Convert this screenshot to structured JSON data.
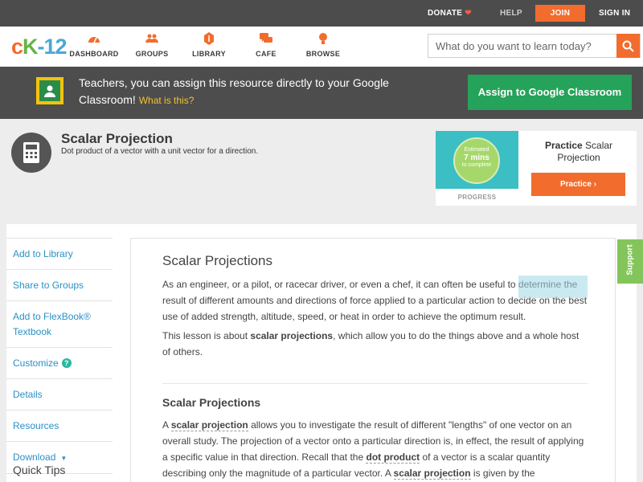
{
  "topbar": {
    "donate": "DONATE",
    "help": "HELP",
    "join": "JOIN",
    "signin": "SIGN IN"
  },
  "header": {
    "logo": {
      "c": "c",
      "k": "K",
      "n": "-12"
    },
    "nav": [
      {
        "label": "DASHBOARD",
        "icon": "dashboard-icon"
      },
      {
        "label": "GROUPS",
        "icon": "groups-icon"
      },
      {
        "label": "LIBRARY",
        "icon": "library-icon"
      },
      {
        "label": "CAFE",
        "icon": "cafe-icon"
      },
      {
        "label": "BROWSE",
        "icon": "browse-icon"
      }
    ],
    "search_placeholder": "What do you want to learn today?"
  },
  "banner": {
    "text": "Teachers, you can assign this resource directly to your Google Classroom!",
    "link": "What is this?",
    "button": "Assign to Google Classroom"
  },
  "concept": {
    "title": "Scalar Projection",
    "subtitle": "Dot product of a vector with a unit vector for a direction."
  },
  "practice": {
    "est_top": "Estimated",
    "est_mid": "7 mins",
    "est_bottom": "to complete",
    "progress": "PROGRESS",
    "title_bold": "Practice",
    "title_rest": "Scalar Projection",
    "button": "Practice"
  },
  "sidebar": {
    "items": [
      "Add to Library",
      "Share to Groups",
      "Add to FlexBook® Textbook",
      "Customize",
      "Details",
      "Resources",
      "Download"
    ],
    "help_badge": "?",
    "quick_tips": "Quick Tips"
  },
  "article": {
    "heading": "Scalar Projections",
    "p1": "As an engineer, or a pilot, or racecar driver, or even a chef, it can often be useful to determine the result of different amounts and directions of force applied to a particular action to decide on the best use of added strength, altitude, speed, or heat in order to achieve the optimum result.",
    "p2_a": "This lesson is about ",
    "p2_b": "scalar projections",
    "p2_c": ", which allow you to do the things above and a whole host of others.",
    "subheading": "Scalar Projections",
    "p3_a": "A ",
    "p3_b": "scalar projection",
    "p3_c": " allows you to investigate the result of different \"lengths\" of one vector on an overall study. The projection of a vector onto a particular direction is, in effect, the result of applying a specific value in that direction. Recall that the ",
    "p3_d": "dot product",
    "p3_e": " of a vector is a scalar quantity describing only the magnitude of a particular vector. A ",
    "p3_f": "scalar projection",
    "p3_g": " is given by the"
  },
  "support": "Support",
  "colors": {
    "accent": "#f26c2d",
    "brand_green": "#67b345",
    "link": "#2a90c8",
    "classroom_green": "#25a35a"
  }
}
